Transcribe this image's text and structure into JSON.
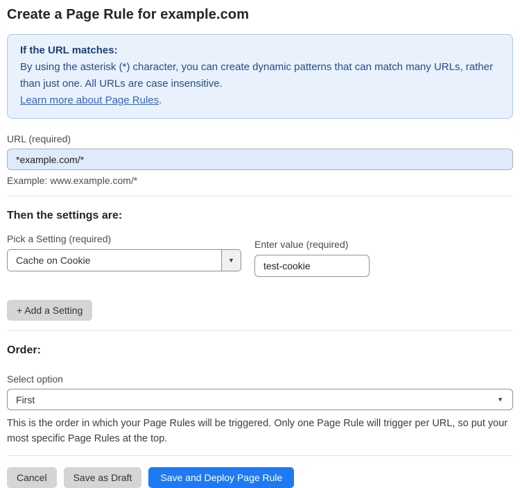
{
  "page": {
    "title": "Create a Page Rule for example.com"
  },
  "info_box": {
    "heading": "If the URL matches:",
    "body": "By using the asterisk (*) character, you can create dynamic patterns that can match many URLs, rather than just one. All URLs are case insensitive.",
    "link_label": "Learn more about Page Rules",
    "link_suffix": "."
  },
  "url_section": {
    "label": "URL (required)",
    "value": "*example.com/*",
    "example": "Example: www.example.com/*"
  },
  "settings_section": {
    "heading": "Then the settings are:",
    "setting_label": "Pick a Setting (required)",
    "setting_value": "Cache on Cookie",
    "value_label": "Enter value (required)",
    "value_input": "test-cookie",
    "add_button_label": "+ Add a Setting"
  },
  "order_section": {
    "heading": "Order:",
    "select_label": "Select option",
    "select_value": "First",
    "helper_text": "This is the order in which your Page Rules will be triggered. Only one Page Rule will trigger per URL, so put your most specific Page Rules at the top."
  },
  "footer": {
    "cancel_label": "Cancel",
    "save_draft_label": "Save as Draft",
    "save_deploy_label": "Save and Deploy Page Rule"
  },
  "icons": {
    "dropdown_arrow": "▼"
  },
  "colors": {
    "accent_blue": "#1d7af2",
    "info_bg": "#e9f2fc",
    "info_border": "#a9c8ee",
    "info_text": "#254b8a",
    "link_blue": "#3565c0",
    "url_input_bg": "#dfeafb",
    "button_gray": "#d5d5d5"
  }
}
